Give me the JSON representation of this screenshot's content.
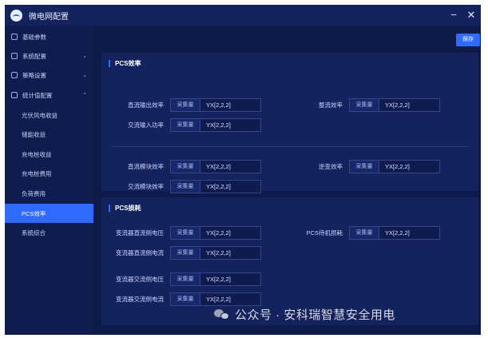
{
  "titlebar": {
    "title": "微电网配置",
    "minimize": "−",
    "close": "✕"
  },
  "sidebar": {
    "items": [
      {
        "label": "基础参数",
        "icon": "gear-icon"
      },
      {
        "label": "系统配置",
        "icon": "network-icon",
        "chevron": "⌄"
      },
      {
        "label": "策略设置",
        "icon": "strategy-icon",
        "chevron": "⌄"
      },
      {
        "label": "统计值配置",
        "icon": "stats-icon",
        "chevron": "⌃"
      }
    ],
    "subitems": [
      {
        "label": "光伏风电收益"
      },
      {
        "label": "储能收益"
      },
      {
        "label": "充电桩收益"
      },
      {
        "label": "充电桩费用"
      },
      {
        "label": "负荷费用"
      },
      {
        "label": "PCS效率",
        "active": true
      },
      {
        "label": "系统综合"
      }
    ]
  },
  "toolbar": {
    "save_label": "保存"
  },
  "panels": {
    "efficiency": {
      "title": "PCS效率",
      "fields": [
        {
          "label": "直流输出效率",
          "tag": "采集量",
          "value": "YX[2,2,2]"
        },
        {
          "label": "整流效率",
          "tag": "采集量",
          "value": "YX[2,2,2]"
        },
        {
          "label": "交流输入功率",
          "tag": "采集量",
          "value": "YX[2,2,2]"
        },
        {
          "label": "直流模块效率",
          "tag": "采集量",
          "value": "YX[2,2,2]"
        },
        {
          "label": "逆变效率",
          "tag": "采集量",
          "value": "YX[2,2,2]"
        },
        {
          "label": "交流模块效率",
          "tag": "采集量",
          "value": "YX[2,2,2]"
        }
      ]
    },
    "loss": {
      "title": "PCS损耗",
      "fields": [
        {
          "label": "变流器直流侧电压",
          "tag": "采集量",
          "value": "YX[2,2,2]"
        },
        {
          "label": "PCS待机损耗",
          "tag": "采集量",
          "value": "YX[2,2,2]"
        },
        {
          "label": "变流器直流侧电流",
          "tag": "采集量",
          "value": "YX[2,2,2]"
        },
        {
          "label": "变流器交流侧电压",
          "tag": "采集量",
          "value": "YX[2,2,2]"
        },
        {
          "label": "变流器交流侧电流",
          "tag": "采集量",
          "value": "YX[2,2,2]"
        }
      ]
    }
  },
  "watermark": {
    "text": "公众号 · 安科瑞智慧安全用电"
  },
  "colors": {
    "accent": "#2f6bff",
    "background": "#0e1a4a",
    "panel": "#14235e"
  }
}
